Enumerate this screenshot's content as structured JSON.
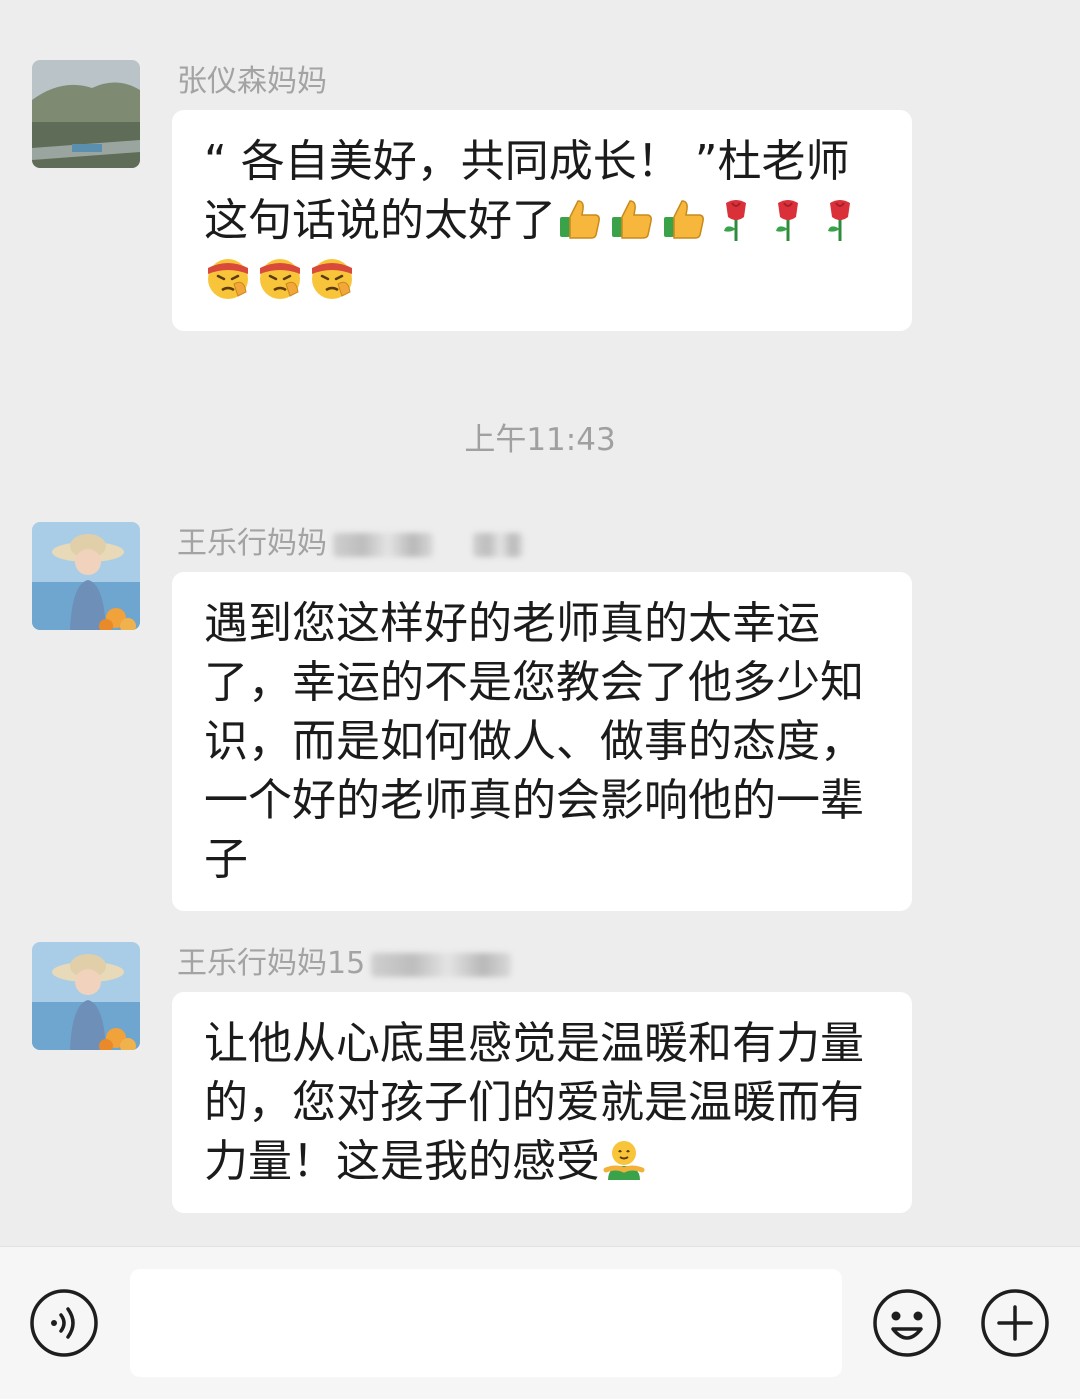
{
  "messages": [
    {
      "sender": "张仪森妈妈",
      "lines": [
        "“ 各自美好，共同成长！ ”杜老师",
        "这句话说的太好了"
      ],
      "emoji": [
        "thumbs-up",
        "thumbs-up",
        "thumbs-up",
        "rose",
        "rose",
        "rose",
        "salute-face",
        "salute-face",
        "salute-face"
      ]
    },
    {
      "sender": "王乐行妈妈",
      "lines": [
        "遇到您这样好的老师真的太幸运",
        "了，幸运的不是您教会了他多少知",
        "识，而是如何做人、做事的态度，",
        "一个好的老师真的会影响他的一辈",
        "子"
      ]
    },
    {
      "sender": "王乐行妈妈15",
      "lines": [
        "让他从心底里感觉是温暖和有力量",
        "的，您对孩子们的爱就是温暖而有",
        "力量！这是我的感受"
      ],
      "emoji": [
        "hug"
      ]
    }
  ],
  "timestamp": "上午11:43",
  "input": {
    "voice_icon": "voice-icon",
    "emoji_icon": "smile-icon",
    "plus_icon": "plus-icon"
  }
}
